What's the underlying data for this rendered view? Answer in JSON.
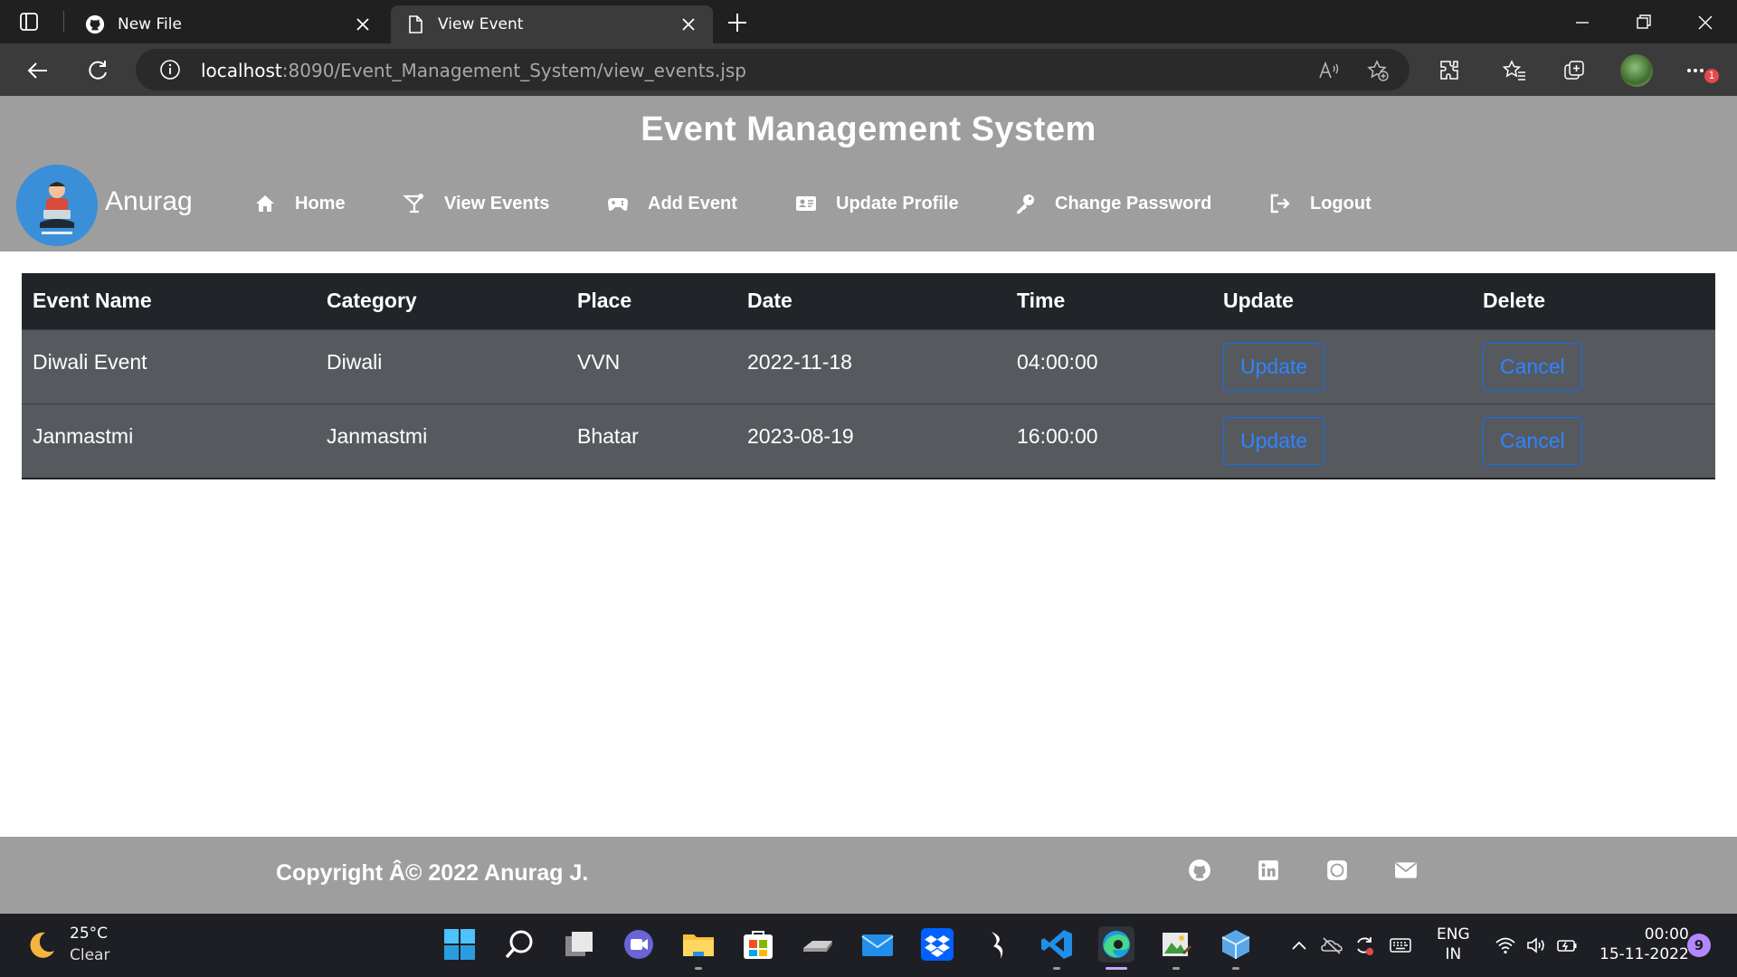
{
  "browser": {
    "tabs": [
      {
        "label": "New File",
        "icon": "github-icon",
        "active": false
      },
      {
        "label": "View Event",
        "icon": "page-icon",
        "active": true
      }
    ],
    "url_host": "localhost",
    "url_rest": ":8090/Event_Management_System/view_events.jsp",
    "notification_count": "1"
  },
  "site": {
    "title": "Event Management System",
    "username": "Anurag",
    "nav": [
      {
        "label": "Home",
        "icon": "home-icon"
      },
      {
        "label": "View Events",
        "icon": "cocktail-icon"
      },
      {
        "label": "Add Event",
        "icon": "gamepad-icon"
      },
      {
        "label": "Update Profile",
        "icon": "id-card-icon"
      },
      {
        "label": "Change Password",
        "icon": "key-icon"
      },
      {
        "label": "Logout",
        "icon": "sign-out-icon"
      }
    ]
  },
  "table": {
    "headers": [
      "Event Name",
      "Category",
      "Place",
      "Date",
      "Time",
      "Update",
      "Delete"
    ],
    "rows": [
      {
        "name": "Diwali Event",
        "category": "Diwali",
        "place": "VVN",
        "date": "2022-11-18",
        "time": "04:00:00",
        "update": "Update",
        "delete": "Cancel"
      },
      {
        "name": "Janmastmi",
        "category": "Janmastmi",
        "place": "Bhatar",
        "date": "2023-08-19",
        "time": "16:00:00",
        "update": "Update",
        "delete": "Cancel"
      }
    ]
  },
  "footer": {
    "copyright": "Copyright Â© 2022 Anurag J.",
    "social": [
      "github-icon",
      "linkedin-icon",
      "whatsapp-icon",
      "mail-icon"
    ]
  },
  "taskbar": {
    "temperature": "25°C",
    "weather": "Clear",
    "lang_top": "ENG",
    "lang_bottom": "IN",
    "time": "00:00",
    "date": "15-11-2022",
    "notification_badge": "9"
  },
  "colors": {
    "header_bg": "#9e9e9e",
    "table_head_bg": "#212529",
    "table_row_bg": "#565a5f",
    "button_blue": "#0d6efd"
  }
}
